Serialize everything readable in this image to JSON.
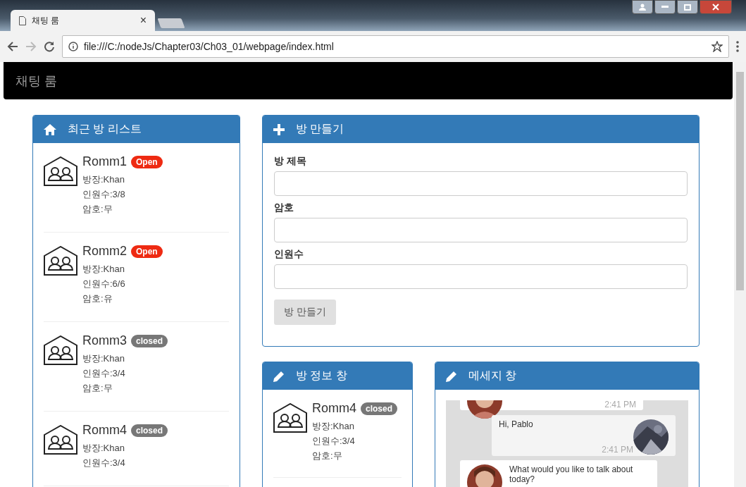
{
  "browser": {
    "tab": {
      "title": "채팅 룸",
      "close": "×"
    },
    "address": "file:///C:/nodeJs/Chapter03/Ch03_01/webpage/index.html"
  },
  "navbar": {
    "brand": "채팅 룸"
  },
  "room_list": {
    "title": "최근 방 리스트",
    "rooms": [
      {
        "name": "Romm1",
        "badge": "Open",
        "open": true,
        "lines": [
          "방장:Khan",
          "인원수:3/8",
          "암호:무"
        ]
      },
      {
        "name": "Romm2",
        "badge": "Open",
        "open": true,
        "lines": [
          "방장:Khan",
          "인원수:6/6",
          "암호:유"
        ]
      },
      {
        "name": "Romm3",
        "badge": "closed",
        "open": false,
        "lines": [
          "방장:Khan",
          "인원수:3/4",
          "암호:무"
        ]
      },
      {
        "name": "Romm4",
        "badge": "closed",
        "open": false,
        "lines": [
          "방장:Khan",
          "인원수:3/4"
        ]
      }
    ]
  },
  "create_room": {
    "title": "방 만들기",
    "fields": [
      {
        "label": "방 제목"
      },
      {
        "label": "암호"
      },
      {
        "label": "인원수"
      }
    ],
    "button": "방 만들기"
  },
  "room_info": {
    "title": "방 정보 창",
    "room": {
      "name": "Romm4",
      "badge": "closed",
      "open": false,
      "lines": [
        "방장:Khan",
        "인원수:3/4",
        "암호:무"
      ]
    }
  },
  "messages": {
    "title": "메세지 창",
    "items": [
      {
        "kind": "in",
        "time": "2:41 PM"
      },
      {
        "kind": "out",
        "text": "Hi, Pablo",
        "time": "2:41 PM"
      },
      {
        "kind": "in",
        "text": "What would you like to talk about today?"
      }
    ]
  }
}
